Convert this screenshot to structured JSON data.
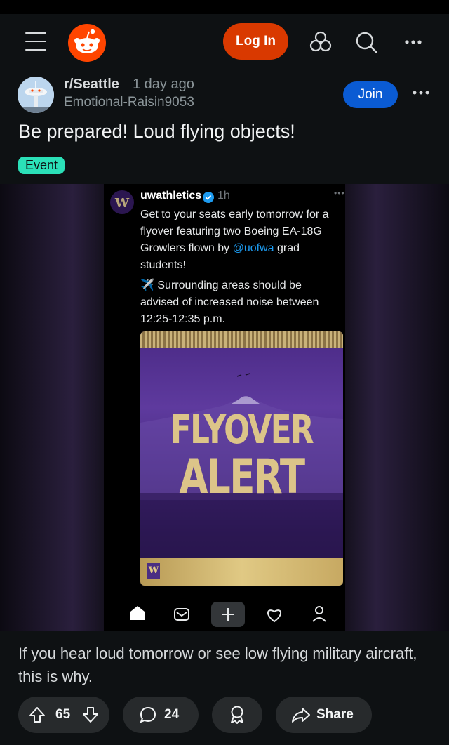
{
  "header": {
    "login_label": "Log In"
  },
  "post": {
    "subreddit": "r/Seattle",
    "time_ago": "1 day ago",
    "author": "Emotional-Raisin9053",
    "join_label": "Join",
    "title": "Be prepared! Loud flying objects!",
    "flair": "Event",
    "body": "If you hear loud tomorrow or see low flying military aircraft, this is why.",
    "upvotes": "65",
    "comments": "24",
    "share_label": "Share"
  },
  "embedded_tweet": {
    "username": "uwathletics",
    "time": "1h",
    "text_part1": "Get to your seats early tomorrow for a flyover featuring two Boeing EA-18G Growlers flown by ",
    "mention": "@uofwa",
    "text_part2": " grad students!",
    "text2": "✈️ Surrounding areas should be advised of increased noise between 12:25-12:35 p.m.",
    "poster_line1": "FLYOVER",
    "poster_line2": "ALERT",
    "poster_logo": "W",
    "avatar_logo": "W"
  },
  "colors": {
    "accent_orange": "#ff4500",
    "login_bg": "#d93900",
    "join_bg": "#0a5bd3",
    "flair_bg": "#2be0b8",
    "background": "#0e1113",
    "pill_bg": "#272a2c"
  }
}
